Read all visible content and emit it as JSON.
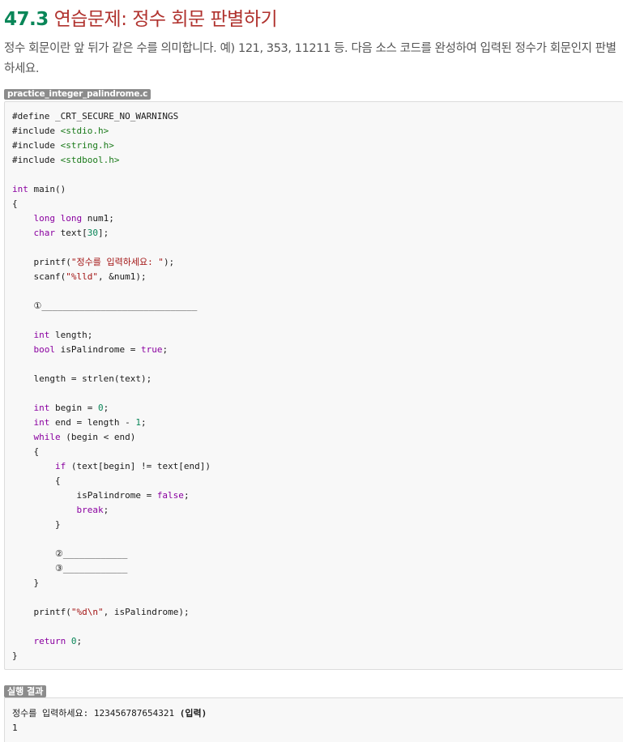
{
  "header": {
    "number": "47.3",
    "title": "연습문제: 정수 회문 판별하기"
  },
  "intro": {
    "text": "정수 회문이란 앞 뒤가 같은 수를 의미합니다. 예) 121, 353, 11211 등. 다음 소스 코드를 완성하여 입력된 정수가 회문인지 판별하세요."
  },
  "source": {
    "filename": "practice_integer_palindrome.c",
    "lines": [
      [
        {
          "t": "#define _CRT_SECURE_NO_WARNINGS"
        }
      ],
      [
        {
          "t": "#include "
        },
        {
          "t": "<stdio.h>",
          "c": "inc"
        }
      ],
      [
        {
          "t": "#include "
        },
        {
          "t": "<string.h>",
          "c": "inc"
        }
      ],
      [
        {
          "t": "#include "
        },
        {
          "t": "<stdbool.h>",
          "c": "inc"
        }
      ],
      [],
      [
        {
          "t": "int",
          "c": "kw"
        },
        {
          "t": " main()"
        }
      ],
      [
        {
          "t": "{"
        }
      ],
      [
        {
          "t": "    "
        },
        {
          "t": "long long",
          "c": "kw"
        },
        {
          "t": " num1;"
        }
      ],
      [
        {
          "t": "    "
        },
        {
          "t": "char",
          "c": "kw"
        },
        {
          "t": " text["
        },
        {
          "t": "30",
          "c": "num"
        },
        {
          "t": "];"
        }
      ],
      [],
      [
        {
          "t": "    printf("
        },
        {
          "t": "\"정수를 입력하세요: \"",
          "c": "str"
        },
        {
          "t": ");"
        }
      ],
      [
        {
          "t": "    scanf("
        },
        {
          "t": "\"%lld\"",
          "c": "str"
        },
        {
          "t": ", &num1);"
        }
      ],
      [],
      [
        {
          "t": "    ①_____________________________"
        }
      ],
      [],
      [
        {
          "t": "    "
        },
        {
          "t": "int",
          "c": "kw"
        },
        {
          "t": " length;"
        }
      ],
      [
        {
          "t": "    "
        },
        {
          "t": "bool",
          "c": "kw"
        },
        {
          "t": " isPalindrome = "
        },
        {
          "t": "true",
          "c": "kw"
        },
        {
          "t": ";"
        }
      ],
      [],
      [
        {
          "t": "    length = strlen(text);"
        }
      ],
      [],
      [
        {
          "t": "    "
        },
        {
          "t": "int",
          "c": "kw"
        },
        {
          "t": " begin = "
        },
        {
          "t": "0",
          "c": "num"
        },
        {
          "t": ";"
        }
      ],
      [
        {
          "t": "    "
        },
        {
          "t": "int",
          "c": "kw"
        },
        {
          "t": " end = length - "
        },
        {
          "t": "1",
          "c": "num"
        },
        {
          "t": ";"
        }
      ],
      [
        {
          "t": "    "
        },
        {
          "t": "while",
          "c": "kw"
        },
        {
          "t": " (begin < end)"
        }
      ],
      [
        {
          "t": "    {"
        }
      ],
      [
        {
          "t": "        "
        },
        {
          "t": "if",
          "c": "kw"
        },
        {
          "t": " (text[begin] != text[end])"
        }
      ],
      [
        {
          "t": "        {"
        }
      ],
      [
        {
          "t": "            isPalindrome = "
        },
        {
          "t": "false",
          "c": "kw"
        },
        {
          "t": ";"
        }
      ],
      [
        {
          "t": "            "
        },
        {
          "t": "break",
          "c": "kw"
        },
        {
          "t": ";"
        }
      ],
      [
        {
          "t": "        }"
        }
      ],
      [],
      [
        {
          "t": "        ②____________"
        }
      ],
      [
        {
          "t": "        ③____________"
        }
      ],
      [
        {
          "t": "    }"
        }
      ],
      [],
      [
        {
          "t": "    printf("
        },
        {
          "t": "\"%d\\n\"",
          "c": "str"
        },
        {
          "t": ", isPalindrome);"
        }
      ],
      [],
      [
        {
          "t": "    "
        },
        {
          "t": "return",
          "c": "kw"
        },
        {
          "t": " "
        },
        {
          "t": "0",
          "c": "num"
        },
        {
          "t": ";"
        }
      ],
      [
        {
          "t": "}"
        }
      ]
    ]
  },
  "output": {
    "label": "실행 결과",
    "lines": [
      [
        {
          "t": "정수를 입력하세요: 123456787654321 "
        },
        {
          "t": "(입력)",
          "c": "bold"
        }
      ],
      [
        {
          "t": "1"
        }
      ]
    ]
  },
  "colors": {
    "title": "#b0322e",
    "keyword": "#8a00a0",
    "include": "#1a7a1a",
    "string": "#a31515",
    "number": "#098658",
    "tag_bg": "#8c8c8c",
    "code_bg": "#f8f8f8"
  }
}
